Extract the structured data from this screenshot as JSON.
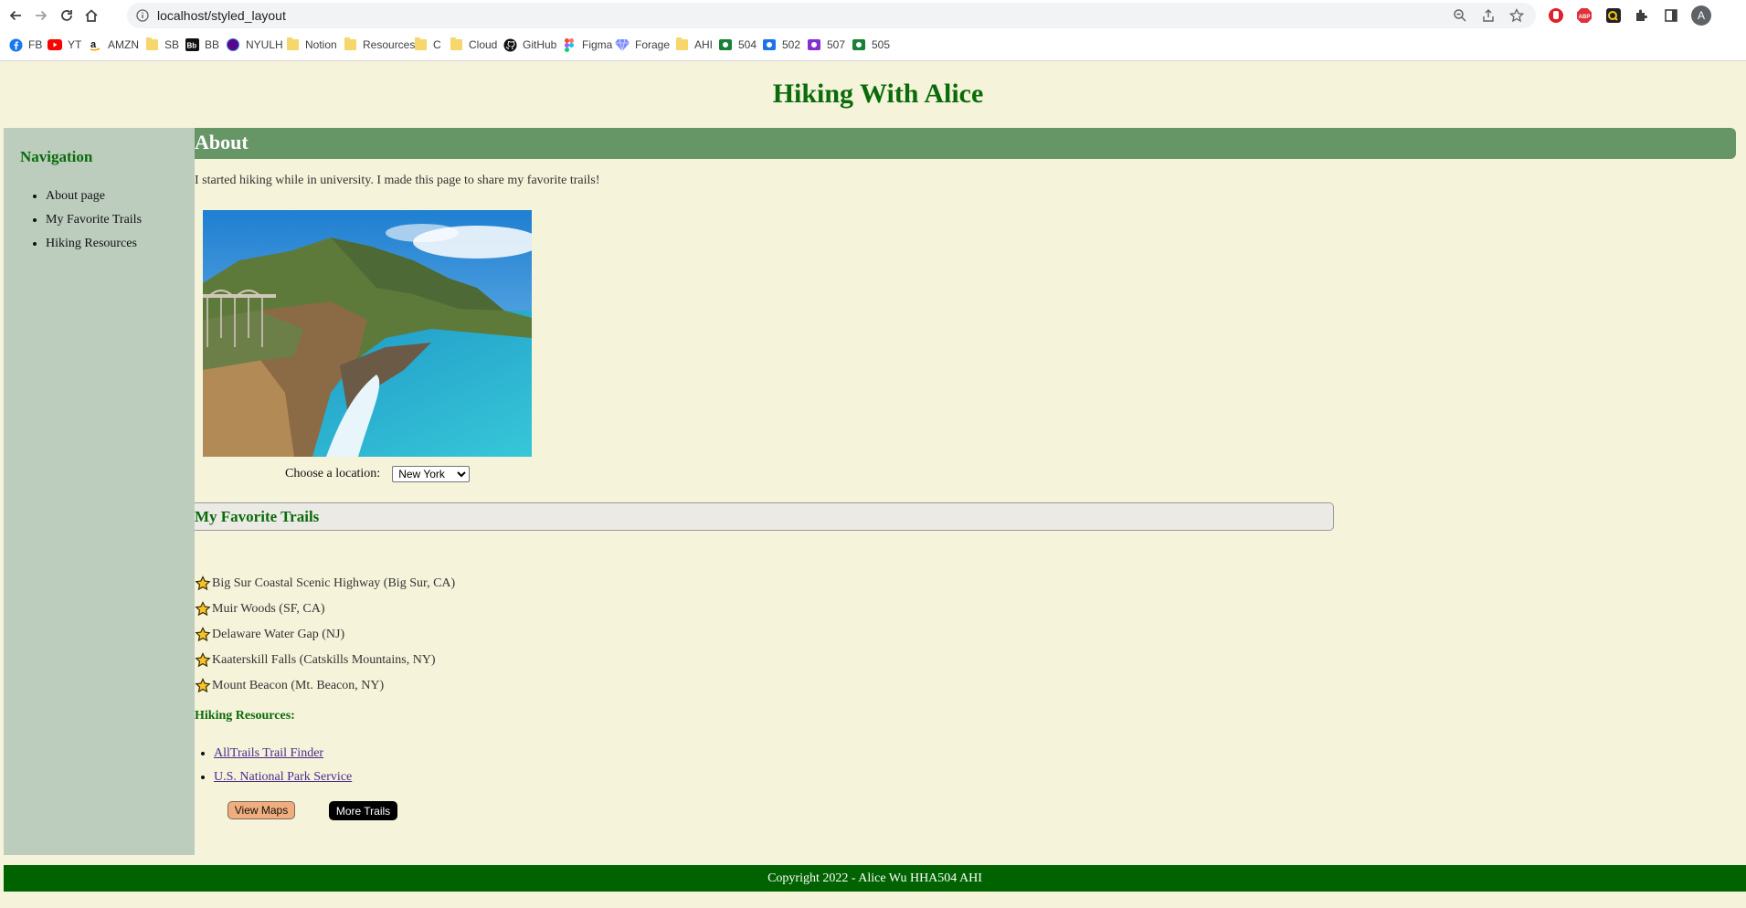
{
  "browser": {
    "url": "localhost/styled_layout",
    "profile_initial": "A",
    "bookmarks": [
      {
        "label": "FB",
        "icon": "facebook-icon"
      },
      {
        "label": "YT",
        "icon": "youtube-icon"
      },
      {
        "label": "AMZN",
        "icon": "amazon-icon"
      },
      {
        "label": "SB",
        "icon": "folder-icon"
      },
      {
        "label": "BB",
        "icon": "blackboard-icon"
      },
      {
        "label": "NYULH",
        "icon": "nyulh-icon"
      },
      {
        "label": "Notion",
        "icon": "folder-icon"
      },
      {
        "label": "Resources",
        "icon": "folder-icon"
      },
      {
        "label": "C",
        "icon": "folder-icon"
      },
      {
        "label": "Cloud",
        "icon": "folder-icon"
      },
      {
        "label": "GitHub",
        "icon": "github-icon"
      },
      {
        "label": "Figma",
        "icon": "figma-icon"
      },
      {
        "label": "Forage",
        "icon": "forage-icon"
      },
      {
        "label": "AHI",
        "icon": "folder-icon"
      },
      {
        "label": "504",
        "icon": "google-classroom-icon"
      },
      {
        "label": "502",
        "icon": "google-classroom-icon"
      },
      {
        "label": "507",
        "icon": "google-classroom-icon"
      },
      {
        "label": "505",
        "icon": "google-classroom-icon"
      }
    ]
  },
  "site": {
    "title": "Hiking With Alice"
  },
  "sidebar": {
    "heading": "Navigation",
    "items": [
      "About page",
      "My Favorite Trails",
      "Hiking Resources"
    ]
  },
  "about": {
    "heading": "About",
    "intro": "I started hiking while in university. I made this page to share my favorite trails!",
    "location_label": "Choose a location:",
    "location_selected": "New York"
  },
  "favorites": {
    "heading": "My Favorite Trails",
    "trails": [
      "Big Sur Coastal Scenic Highway (Big Sur, CA)",
      "Muir Woods (SF, CA)",
      "Delaware Water Gap (NJ)",
      "Kaaterskill Falls (Catskills Mountains, NY)",
      "Mount Beacon (Mt. Beacon, NY)"
    ]
  },
  "resources": {
    "heading": "Hiking Resources:",
    "links": [
      "AllTrails Trail Finder",
      "U.S. National Park Service"
    ]
  },
  "buttons": {
    "view_maps": "View Maps",
    "more_trails": "More Trails"
  },
  "footer": {
    "text": "Copyright 2022 - Alice Wu HHA504 AHI"
  },
  "colors": {
    "page_bg": "#f5f3da",
    "title_green": "#0a6b0a",
    "sidebar_bg": "#bccdbe",
    "about_bar": "#669566",
    "footer_bg": "#006300",
    "view_maps_bg": "#f0ad7e",
    "more_trails_bg": "#000000"
  }
}
